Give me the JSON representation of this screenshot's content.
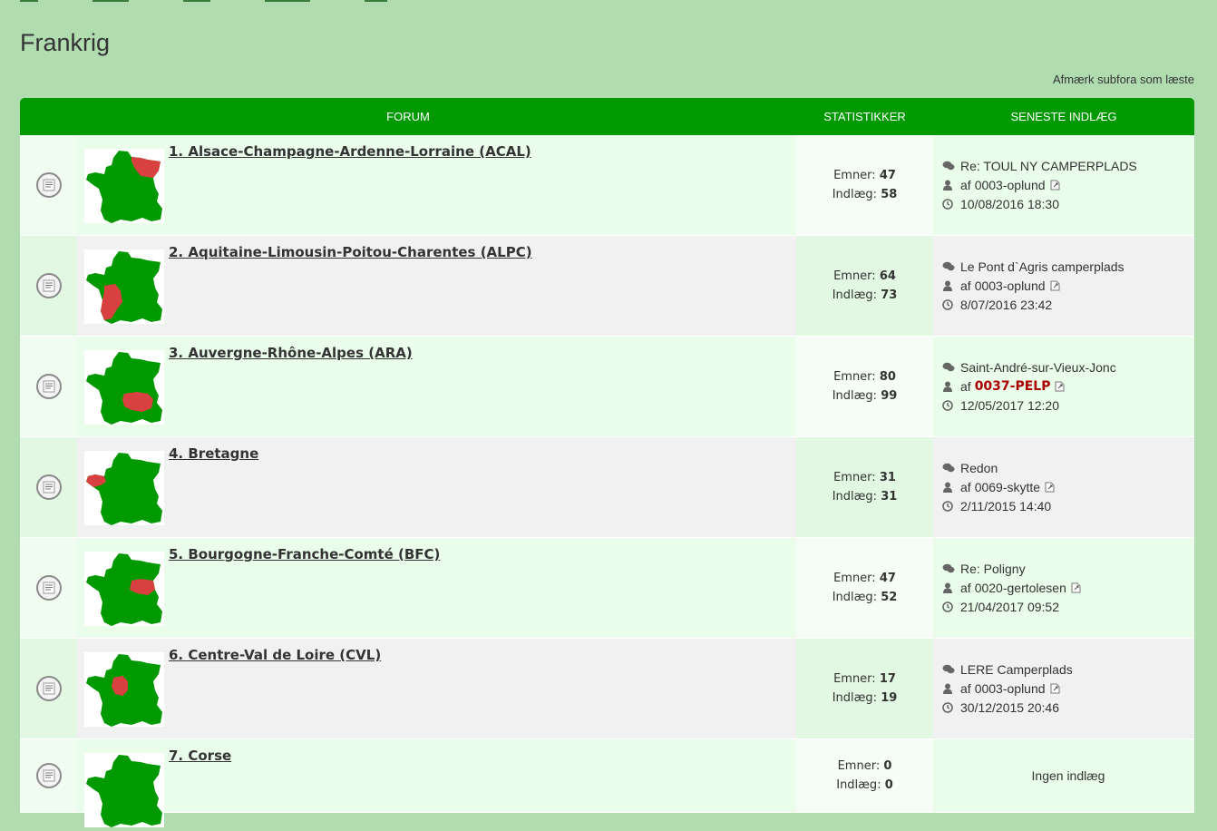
{
  "page": {
    "title": "Frankrig",
    "mark_read": "Afmærk subfora som læste"
  },
  "table": {
    "col_forum": "FORUM",
    "col_stats": "STATISTIKKER",
    "col_last": "SENESTE INDLÆG",
    "topics_label": "Emner:",
    "posts_label": "Indlæg:",
    "by_label": "af"
  },
  "colors": {
    "header": "#009900",
    "map_green": "#009900",
    "map_red": "#d94040",
    "special_user": "#aa0000"
  },
  "forums": [
    {
      "title": "1. Alsace-Champagne-Ardenne-Lorraine (ACAL)",
      "region": "ACAL",
      "topics": "47",
      "posts": "58",
      "last_subject": "Re: TOUL NY CAMPERPLADS",
      "last_user": "0003-oplund",
      "last_user_special": false,
      "last_time": "10/08/2016 18:30"
    },
    {
      "title": "2. Aquitaine-Limousin-Poitou-Charentes (ALPC)",
      "region": "ALPC",
      "topics": "64",
      "posts": "73",
      "last_subject": "Le Pont d`Agris camperplads",
      "last_user": "0003-oplund",
      "last_user_special": false,
      "last_time": "8/07/2016 23:42"
    },
    {
      "title": "3. Auvergne-Rhône-Alpes (ARA)",
      "region": "ARA",
      "topics": "80",
      "posts": "99",
      "last_subject": "Saint-André-sur-Vieux-Jonc",
      "last_user": "0037-PELP",
      "last_user_special": true,
      "last_time": "12/05/2017 12:20"
    },
    {
      "title": "4. Bretagne",
      "region": "BRE",
      "topics": "31",
      "posts": "31",
      "last_subject": "Redon",
      "last_user": "0069-skytte",
      "last_user_special": false,
      "last_time": "2/11/2015 14:40"
    },
    {
      "title": "5. Bourgogne-Franche-Comté (BFC)",
      "region": "BFC",
      "topics": "47",
      "posts": "52",
      "last_subject": "Re: Poligny",
      "last_user": "0020-gertolesen",
      "last_user_special": false,
      "last_time": "21/04/2017 09:52"
    },
    {
      "title": "6. Centre-Val de Loire (CVL)",
      "region": "CVL",
      "topics": "17",
      "posts": "19",
      "last_subject": "LERE Camperplads",
      "last_user": "0003-oplund",
      "last_user_special": false,
      "last_time": "30/12/2015 20:46"
    },
    {
      "title": "7. Corse",
      "region": "COR",
      "topics": "0",
      "posts": "0",
      "no_posts": "Ingen indlæg"
    }
  ]
}
